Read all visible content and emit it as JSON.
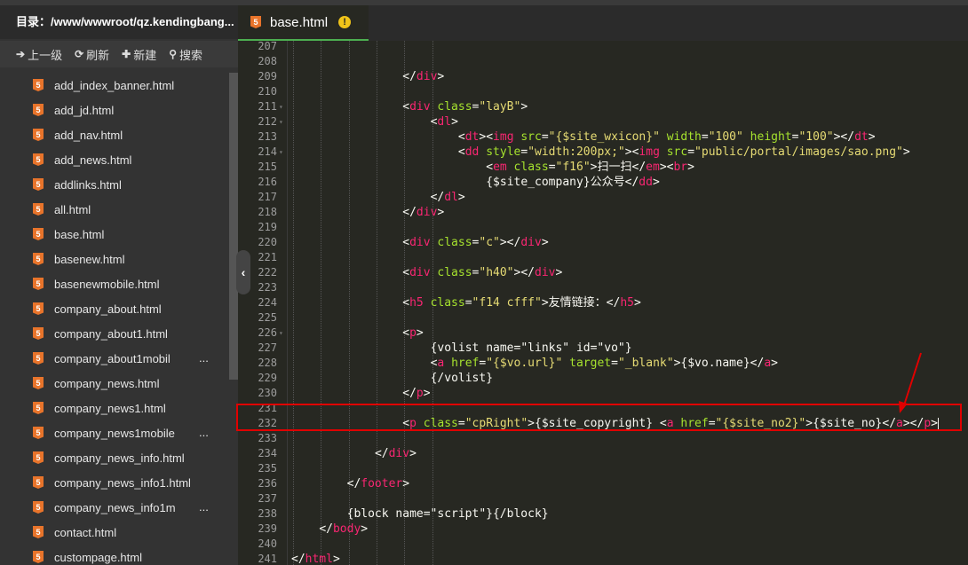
{
  "sidebar": {
    "title": "目录：/www/wwwroot/qz.kendingbang...",
    "toolbar": [
      {
        "icon": "arrow-up-icon",
        "glyph": "➔",
        "label": "上一级"
      },
      {
        "icon": "refresh-icon",
        "glyph": "⟳",
        "label": "刷新"
      },
      {
        "icon": "plus-icon",
        "glyph": "✚",
        "label": "新建"
      },
      {
        "icon": "search-icon",
        "glyph": "⚲",
        "label": "搜索"
      }
    ],
    "files": [
      {
        "name": "add_index_banner.html",
        "more": ""
      },
      {
        "name": "add_jd.html",
        "more": ""
      },
      {
        "name": "add_nav.html",
        "more": ""
      },
      {
        "name": "add_news.html",
        "more": ""
      },
      {
        "name": "addlinks.html",
        "more": ""
      },
      {
        "name": "all.html",
        "more": ""
      },
      {
        "name": "base.html",
        "more": ""
      },
      {
        "name": "basenew.html",
        "more": ""
      },
      {
        "name": "basenewmobile.html",
        "more": ""
      },
      {
        "name": "company_about.html",
        "more": ""
      },
      {
        "name": "company_about1.html",
        "more": ""
      },
      {
        "name": "company_about1mobil",
        "more": "..."
      },
      {
        "name": "company_news.html",
        "more": ""
      },
      {
        "name": "company_news1.html",
        "more": ""
      },
      {
        "name": "company_news1mobile",
        "more": "..."
      },
      {
        "name": "company_news_info.html",
        "more": ""
      },
      {
        "name": "company_news_info1.html",
        "more": ""
      },
      {
        "name": "company_news_info1m",
        "more": "..."
      },
      {
        "name": "contact.html",
        "more": ""
      },
      {
        "name": "custompage.html",
        "more": ""
      }
    ],
    "collapse_glyph": "‹"
  },
  "tab": {
    "label": "base.html",
    "icon_letter": "5",
    "warn": "!"
  },
  "editor": {
    "lines": [
      {
        "n": "207",
        "fold": "",
        "indent": 0,
        "tokens": []
      },
      {
        "n": "208",
        "fold": "",
        "indent": 0,
        "tokens": []
      },
      {
        "n": "209",
        "fold": "",
        "indent": 4,
        "tokens": [
          [
            "b",
            "</"
          ],
          [
            "t",
            "div"
          ],
          [
            "b",
            ">"
          ]
        ]
      },
      {
        "n": "210",
        "fold": "",
        "indent": 0,
        "tokens": []
      },
      {
        "n": "211",
        "fold": "▾",
        "indent": 4,
        "tokens": [
          [
            "b",
            "<"
          ],
          [
            "t",
            "div"
          ],
          [
            "x",
            " "
          ],
          [
            "a",
            "class"
          ],
          [
            "b",
            "="
          ],
          [
            "s",
            "\"layB\""
          ],
          [
            "b",
            ">"
          ]
        ]
      },
      {
        "n": "212",
        "fold": "▾",
        "indent": 5,
        "tokens": [
          [
            "b",
            "<"
          ],
          [
            "t",
            "dl"
          ],
          [
            "b",
            ">"
          ]
        ]
      },
      {
        "n": "213",
        "fold": "",
        "indent": 6,
        "tokens": [
          [
            "b",
            "<"
          ],
          [
            "t",
            "dt"
          ],
          [
            "b",
            "><"
          ],
          [
            "t",
            "img"
          ],
          [
            "x",
            " "
          ],
          [
            "a",
            "src"
          ],
          [
            "b",
            "="
          ],
          [
            "s",
            "\"{$site_wxicon}\""
          ],
          [
            "x",
            " "
          ],
          [
            "a",
            "width"
          ],
          [
            "b",
            "="
          ],
          [
            "s",
            "\"100\""
          ],
          [
            "x",
            " "
          ],
          [
            "a",
            "height"
          ],
          [
            "b",
            "="
          ],
          [
            "s",
            "\"100\""
          ],
          [
            "b",
            "></"
          ],
          [
            "t",
            "dt"
          ],
          [
            "b",
            ">"
          ]
        ]
      },
      {
        "n": "214",
        "fold": "▾",
        "indent": 6,
        "tokens": [
          [
            "b",
            "<"
          ],
          [
            "t",
            "dd"
          ],
          [
            "x",
            " "
          ],
          [
            "a",
            "style"
          ],
          [
            "b",
            "="
          ],
          [
            "s",
            "\"width:200px;\""
          ],
          [
            "b",
            "><"
          ],
          [
            "t",
            "img"
          ],
          [
            "x",
            " "
          ],
          [
            "a",
            "src"
          ],
          [
            "b",
            "="
          ],
          [
            "s",
            "\"public/portal/images/sao.png\""
          ],
          [
            "b",
            ">"
          ]
        ]
      },
      {
        "n": "215",
        "fold": "",
        "indent": 7,
        "tokens": [
          [
            "b",
            "<"
          ],
          [
            "t",
            "em"
          ],
          [
            "x",
            " "
          ],
          [
            "a",
            "class"
          ],
          [
            "b",
            "="
          ],
          [
            "s",
            "\"f16\""
          ],
          [
            "b",
            ">"
          ],
          [
            "x",
            "扫一扫"
          ],
          [
            "b",
            "</"
          ],
          [
            "t",
            "em"
          ],
          [
            "b",
            "><"
          ],
          [
            "t",
            "br"
          ],
          [
            "b",
            ">"
          ]
        ]
      },
      {
        "n": "216",
        "fold": "",
        "indent": 7,
        "tokens": [
          [
            "x",
            "{$site_company}公众号"
          ],
          [
            "b",
            "</"
          ],
          [
            "t",
            "dd"
          ],
          [
            "b",
            ">"
          ]
        ]
      },
      {
        "n": "217",
        "fold": "",
        "indent": 5,
        "tokens": [
          [
            "b",
            "</"
          ],
          [
            "t",
            "dl"
          ],
          [
            "b",
            ">"
          ]
        ]
      },
      {
        "n": "218",
        "fold": "",
        "indent": 4,
        "tokens": [
          [
            "b",
            "</"
          ],
          [
            "t",
            "div"
          ],
          [
            "b",
            ">"
          ]
        ]
      },
      {
        "n": "219",
        "fold": "",
        "indent": 0,
        "tokens": []
      },
      {
        "n": "220",
        "fold": "",
        "indent": 4,
        "tokens": [
          [
            "b",
            "<"
          ],
          [
            "t",
            "div"
          ],
          [
            "x",
            " "
          ],
          [
            "a",
            "class"
          ],
          [
            "b",
            "="
          ],
          [
            "s",
            "\"c\""
          ],
          [
            "b",
            "></"
          ],
          [
            "t",
            "div"
          ],
          [
            "b",
            ">"
          ]
        ]
      },
      {
        "n": "221",
        "fold": "",
        "indent": 0,
        "tokens": []
      },
      {
        "n": "222",
        "fold": "",
        "indent": 4,
        "tokens": [
          [
            "b",
            "<"
          ],
          [
            "t",
            "div"
          ],
          [
            "x",
            " "
          ],
          [
            "a",
            "class"
          ],
          [
            "b",
            "="
          ],
          [
            "s",
            "\"h40\""
          ],
          [
            "b",
            "></"
          ],
          [
            "t",
            "div"
          ],
          [
            "b",
            ">"
          ]
        ]
      },
      {
        "n": "223",
        "fold": "",
        "indent": 0,
        "tokens": []
      },
      {
        "n": "224",
        "fold": "",
        "indent": 4,
        "tokens": [
          [
            "b",
            "<"
          ],
          [
            "t",
            "h5"
          ],
          [
            "x",
            " "
          ],
          [
            "a",
            "class"
          ],
          [
            "b",
            "="
          ],
          [
            "s",
            "\"f14 cfff\""
          ],
          [
            "b",
            ">"
          ],
          [
            "x",
            "友情链接："
          ],
          [
            "b",
            "</"
          ],
          [
            "t",
            "h5"
          ],
          [
            "b",
            ">"
          ]
        ]
      },
      {
        "n": "225",
        "fold": "",
        "indent": 0,
        "tokens": []
      },
      {
        "n": "226",
        "fold": "▾",
        "indent": 4,
        "tokens": [
          [
            "b",
            "<"
          ],
          [
            "t",
            "p"
          ],
          [
            "b",
            ">"
          ]
        ]
      },
      {
        "n": "227",
        "fold": "",
        "indent": 5,
        "tokens": [
          [
            "x",
            "{volist name=\"links\" id=\"vo\"}"
          ]
        ]
      },
      {
        "n": "228",
        "fold": "",
        "indent": 5,
        "tokens": [
          [
            "b",
            "<"
          ],
          [
            "t",
            "a"
          ],
          [
            "x",
            " "
          ],
          [
            "a",
            "href"
          ],
          [
            "b",
            "="
          ],
          [
            "s",
            "\"{$vo.url}\""
          ],
          [
            "x",
            " "
          ],
          [
            "a",
            "target"
          ],
          [
            "b",
            "="
          ],
          [
            "s",
            "\"_blank\""
          ],
          [
            "b",
            ">"
          ],
          [
            "x",
            "{$vo.name}"
          ],
          [
            "b",
            "</"
          ],
          [
            "t",
            "a"
          ],
          [
            "b",
            ">"
          ]
        ]
      },
      {
        "n": "229",
        "fold": "",
        "indent": 5,
        "tokens": [
          [
            "x",
            "{/volist}"
          ]
        ]
      },
      {
        "n": "230",
        "fold": "",
        "indent": 4,
        "tokens": [
          [
            "b",
            "</"
          ],
          [
            "t",
            "p"
          ],
          [
            "b",
            ">"
          ]
        ]
      },
      {
        "n": "231",
        "fold": "",
        "indent": 0,
        "tokens": []
      },
      {
        "n": "232",
        "fold": "",
        "indent": 4,
        "tokens": [
          [
            "b",
            "<"
          ],
          [
            "t",
            "p"
          ],
          [
            "x",
            " "
          ],
          [
            "a",
            "class"
          ],
          [
            "b",
            "="
          ],
          [
            "s",
            "\"cpRight\""
          ],
          [
            "b",
            ">"
          ],
          [
            "x",
            "{$site_copyright} "
          ],
          [
            "b",
            "<"
          ],
          [
            "t",
            "a"
          ],
          [
            "x",
            " "
          ],
          [
            "a",
            "href"
          ],
          [
            "b",
            "="
          ],
          [
            "s",
            "\"{$site_no2}\""
          ],
          [
            "b",
            ">"
          ],
          [
            "x",
            "{$site_no}"
          ],
          [
            "b",
            "</"
          ],
          [
            "t",
            "a"
          ],
          [
            "b",
            "></"
          ],
          [
            "t",
            "p"
          ],
          [
            "b",
            ">"
          ]
        ],
        "cursor": true
      },
      {
        "n": "233",
        "fold": "",
        "indent": 0,
        "tokens": []
      },
      {
        "n": "234",
        "fold": "",
        "indent": 3,
        "tokens": [
          [
            "b",
            "</"
          ],
          [
            "t",
            "div"
          ],
          [
            "b",
            ">"
          ]
        ]
      },
      {
        "n": "235",
        "fold": "",
        "indent": 0,
        "tokens": []
      },
      {
        "n": "236",
        "fold": "",
        "indent": 2,
        "tokens": [
          [
            "b",
            "</"
          ],
          [
            "t",
            "footer"
          ],
          [
            "b",
            ">"
          ]
        ]
      },
      {
        "n": "237",
        "fold": "",
        "indent": 0,
        "tokens": []
      },
      {
        "n": "238",
        "fold": "",
        "indent": 2,
        "tokens": [
          [
            "x",
            "{block name=\"script\"}{/block}"
          ]
        ]
      },
      {
        "n": "239",
        "fold": "",
        "indent": 1,
        "tokens": [
          [
            "b",
            "</"
          ],
          [
            "t",
            "body"
          ],
          [
            "b",
            ">"
          ]
        ]
      },
      {
        "n": "240",
        "fold": "",
        "indent": 0,
        "tokens": []
      },
      {
        "n": "241",
        "fold": "",
        "indent": 0,
        "tokens": [
          [
            "b",
            "</"
          ],
          [
            "t",
            "html"
          ],
          [
            "b",
            ">"
          ]
        ]
      }
    ]
  },
  "annotation": {
    "box_color": "#e00000",
    "arrow_color": "#e00000"
  }
}
